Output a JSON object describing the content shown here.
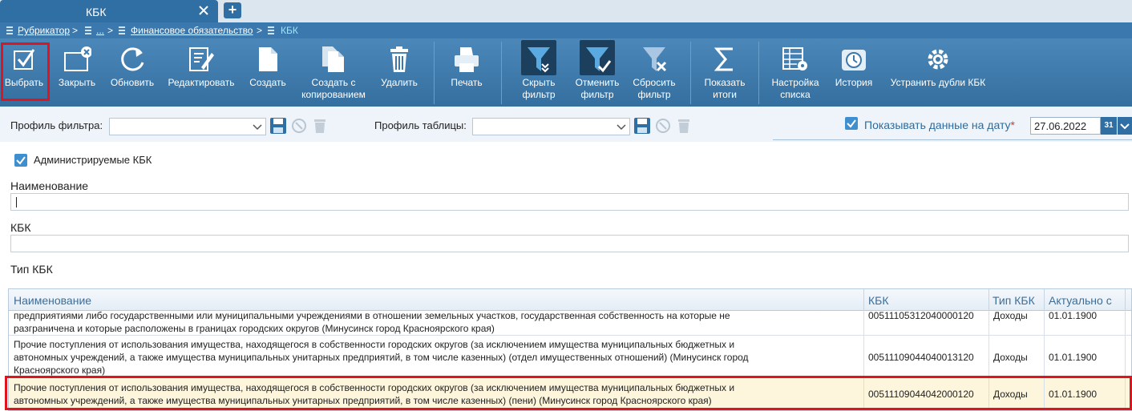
{
  "tab": {
    "title": "КБК"
  },
  "breadcrumb": {
    "items": [
      "Рубрикатор",
      "...",
      "Финансовое обязательство"
    ],
    "current": "КБК",
    "separator": ">"
  },
  "toolbar": {
    "select": "Выбрать",
    "close": "Закрыть",
    "refresh": "Обновить",
    "edit": "Редактировать",
    "create": "Создать",
    "create_copy_1": "Создать с",
    "create_copy_2": "копированием",
    "delete": "Удалить",
    "print": "Печать",
    "hide_filter_1": "Скрыть",
    "hide_filter_2": "фильтр",
    "cancel_filter_1": "Отменить",
    "cancel_filter_2": "фильтр",
    "reset_filter_1": "Сбросить",
    "reset_filter_2": "фильтр",
    "totals_1": "Показать",
    "totals_2": "итоги",
    "list_settings_1": "Настройка",
    "list_settings_2": "списка",
    "history": "История",
    "dedupe": "Устранить дубли КБК"
  },
  "filters": {
    "filter_profile_label": "Профиль фильтра:",
    "filter_profile_value": "",
    "table_profile_label": "Профиль таблицы:",
    "table_profile_value": "",
    "show_on_date_label": "Показывать данные на дату",
    "required_mark": "*",
    "date_value": "27.06.2022",
    "calendar_btn": "31"
  },
  "form": {
    "administered_label": "Администрируемые КБК",
    "administered_checked": true,
    "name_label": "Наименование",
    "name_value": "",
    "kbk_label": "КБК",
    "kbk_value": "",
    "kbk_type_label": "Тип КБК"
  },
  "grid": {
    "columns": [
      "Наименование",
      "КБК",
      "Тип КБК",
      "Актуально с"
    ],
    "rows": [
      {
        "name_lines": [
          "предприятиями либо государственными или муниципальными учреждениями в отношении земельных участков, государственная собственность на которые не",
          "разграничена и которые расположены в границах городских округов (Минусинск город Красноярского края)"
        ],
        "kbk": "00511105312040000120",
        "type": "Доходы",
        "date": "01.01.1900"
      },
      {
        "name_lines": [
          "Прочие поступления от использования имущества, находящегося в собственности городских округов (за исключением имущества муниципальных бюджетных и",
          "автономных учреждений, а также имущества муниципальных унитарных предприятий, в том числе казенных) (отдел имущественных отношений) (Минусинск город",
          "Красноярского края)"
        ],
        "kbk": "00511109044040013120",
        "type": "Доходы",
        "date": "01.01.1900"
      },
      {
        "name_lines": [
          "Прочие поступления от использования имущества, находящегося в собственности городских округов (за исключением имущества муниципальных бюджетных и",
          "автономных учреждений, а также имущества муниципальных унитарных предприятий, в том числе казенных) (пени) (Минусинск город Красноярского края)"
        ],
        "kbk": "00511109044042000120",
        "type": "Доходы",
        "date": "01.01.1900"
      }
    ]
  },
  "colors": {
    "accent": "#2f6fa3",
    "highlight": "#e0141f",
    "selected_row": "#fdf6dc"
  }
}
